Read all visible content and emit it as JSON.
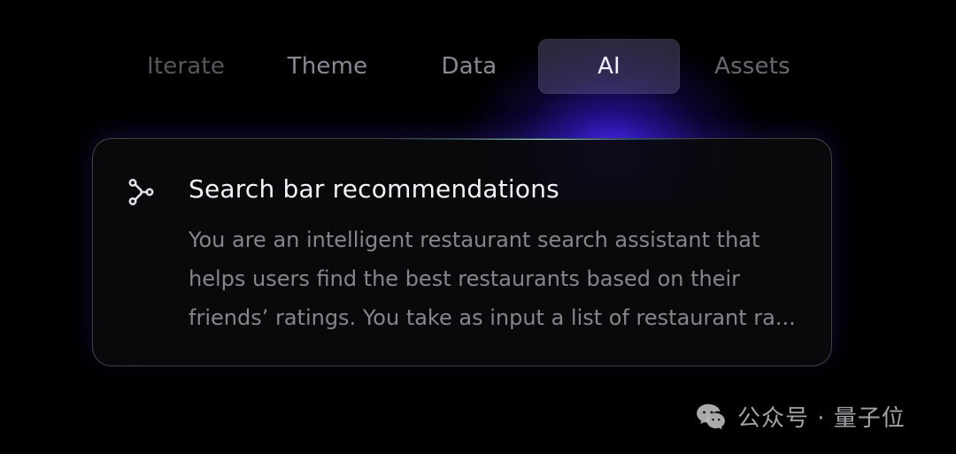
{
  "tabs": [
    {
      "label": "Iterate"
    },
    {
      "label": "Theme"
    },
    {
      "label": "Data"
    },
    {
      "label": "AI",
      "selected": true
    },
    {
      "label": "Assets"
    }
  ],
  "card": {
    "icon": "branch-icon",
    "title": "Search bar recommendations",
    "description": "You are an intelligent restaurant search assistant that helps users find the best restaurants based on their friends’ ratings. You take as input a list of restaurant ra..."
  },
  "watermark": {
    "icon": "wechat-icon",
    "text": "公众号 · 量子位"
  },
  "colors": {
    "background": "#000000",
    "tab_selected_bg": "#3a3752",
    "glow": "#4b2cff"
  }
}
